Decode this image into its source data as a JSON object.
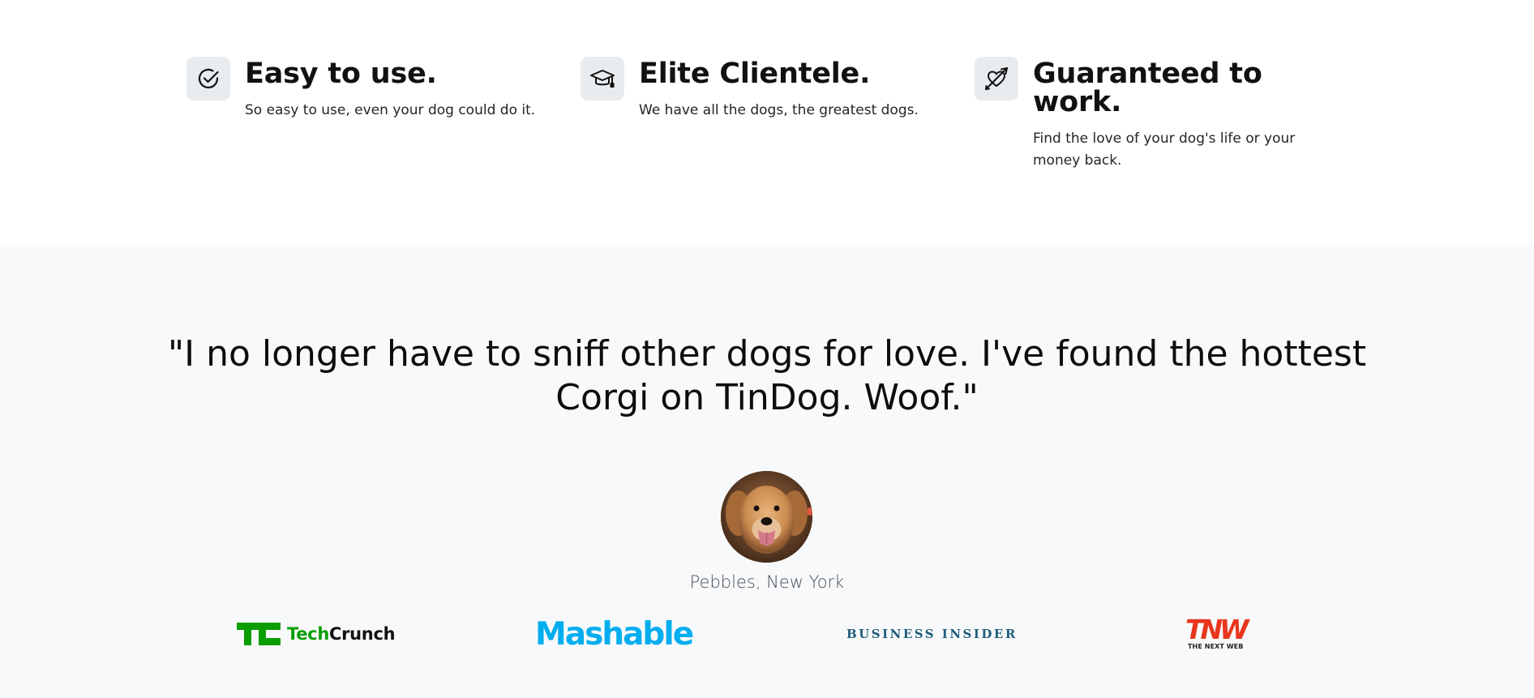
{
  "features": [
    {
      "icon": "check-circle-icon",
      "title": "Easy to use.",
      "description": "So easy to use, even your dog could do it."
    },
    {
      "icon": "mortarboard-icon",
      "title": "Elite Clientele.",
      "description": "We have all the dogs, the greatest dogs."
    },
    {
      "icon": "heart-arrow-icon",
      "title": "Guaranteed to work.",
      "description": "Find the love of your dog's life or your money back."
    }
  ],
  "testimonial": {
    "quote": "\"I no longer have to sniff other dogs for love. I've found the hottest Corgi on TinDog. Woof.\"",
    "author": "Pebbles, New York"
  },
  "press": {
    "techcrunch_tech": "Tech",
    "techcrunch_crunch": "Crunch",
    "mashable": "Mashable",
    "business_insider": "BUSINESS INSIDER",
    "tnw": "TNW",
    "tnw_sub": "THE NEXT WEB"
  },
  "colors": {
    "section_bg": "#f8f9fa",
    "icon_bg": "#e9ecef",
    "techcrunch_green": "#0a9e01",
    "mashable_blue": "#00aeef",
    "business_insider_blue": "#1f5d7a",
    "tnw_red": "#e8361e"
  }
}
